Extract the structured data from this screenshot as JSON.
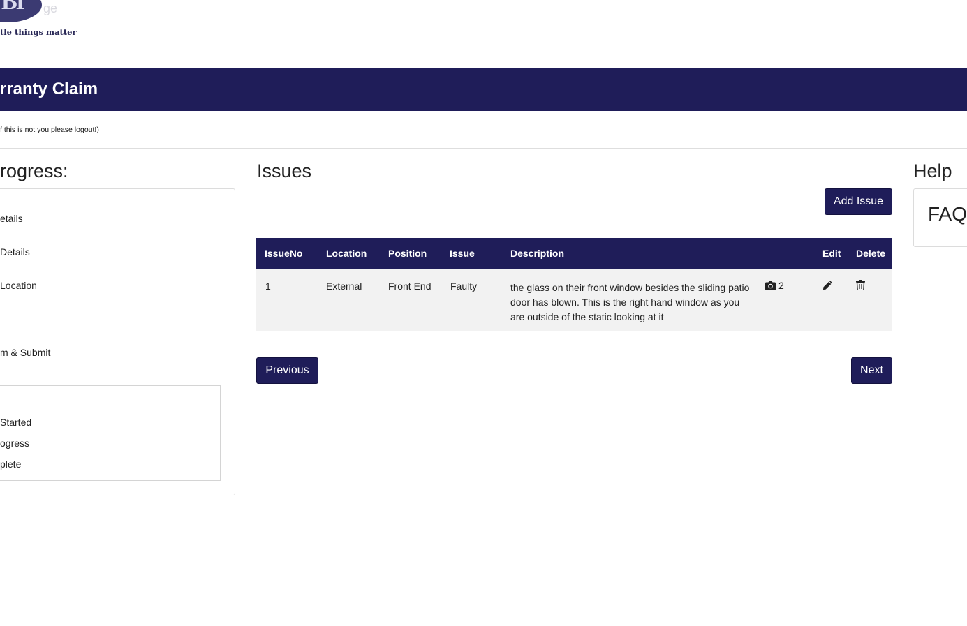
{
  "logo": {
    "mark": "BI",
    "ghost_text": "ge",
    "tagline": "tle things matter"
  },
  "banner": {
    "title": "rranty Claim"
  },
  "user_note": "f this is not you please logout!)",
  "progress": {
    "title": "rogress:",
    "steps": [
      "etails",
      " Details",
      " Location",
      "m & Submit"
    ],
    "legend": [
      "Started",
      "ogress",
      "plete"
    ]
  },
  "issues": {
    "title": "Issues",
    "add_button": "Add Issue",
    "columns": {
      "issue_no": "IssueNo",
      "location": "Location",
      "position": "Position",
      "issue": "Issue",
      "description": "Description",
      "edit": "Edit",
      "delete": "Delete"
    },
    "rows": [
      {
        "issue_no": "1",
        "location": "External",
        "position": "Front End",
        "issue": "Faulty",
        "description": "the glass on their front window besides the sliding patio door has blown. This is the right hand window as you are outside of the static looking at it",
        "photo_count": "2",
        "photo_icon": "camera-icon",
        "edit_icon": "pencil-icon",
        "delete_icon": "trash-icon"
      }
    ],
    "previous_button": "Previous",
    "next_button": "Next"
  },
  "help": {
    "title": "Help",
    "faq": "FAQ"
  },
  "colors": {
    "brand_navy": "#1f1d59",
    "row_background": "#f2f2f2"
  }
}
